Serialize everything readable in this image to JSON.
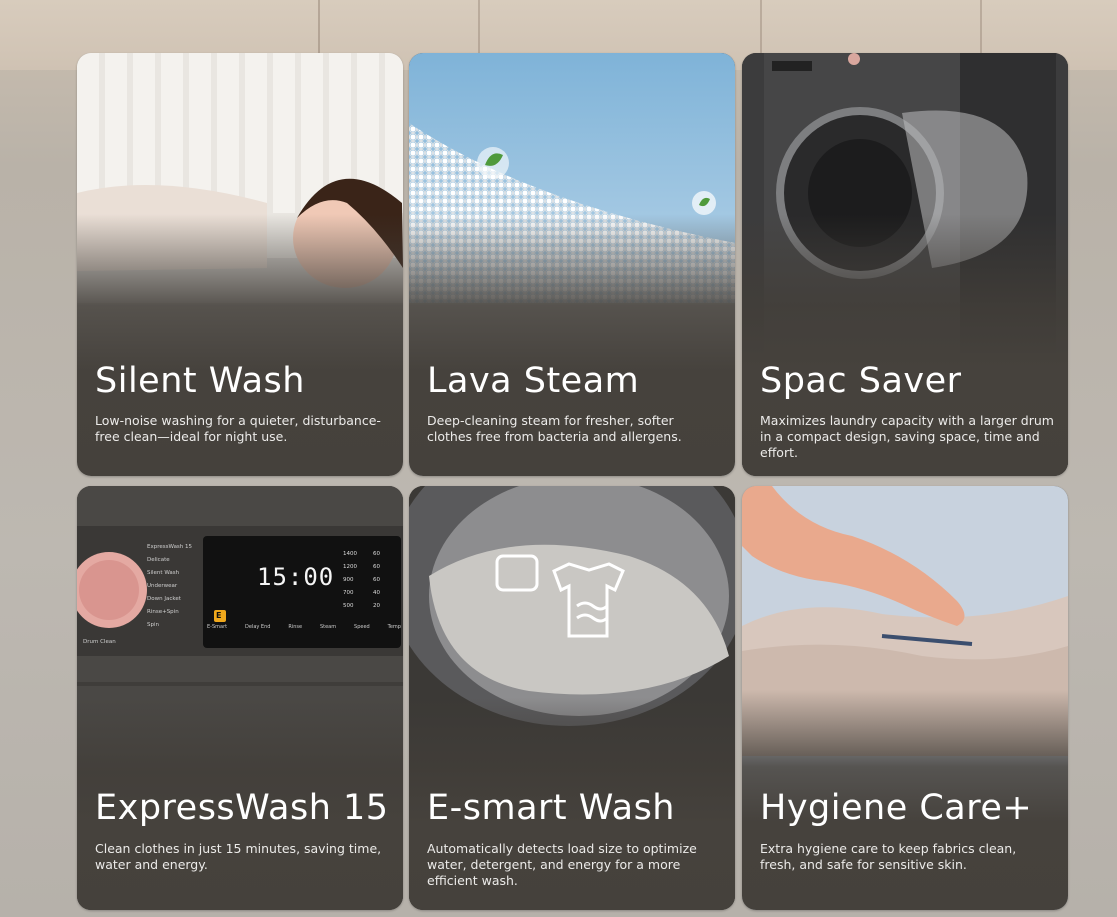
{
  "cards": [
    {
      "title": "Silent Wash",
      "desc": "Low-noise washing for a quieter, disturbance-free clean—ideal for night use."
    },
    {
      "title": "Lava Steam",
      "desc": "Deep-cleaning steam for fresher, softer clothes free from bacteria and allergens."
    },
    {
      "title": "Spac Saver",
      "desc": "Maximizes laundry capacity with a larger drum in a compact design, saving space, time and effort."
    },
    {
      "title": "ExpressWash 15",
      "desc": "Clean clothes in just 15 minutes, saving time, water and energy."
    },
    {
      "title": "E-smart Wash",
      "desc": "Automatically detects load size to optimize water, detergent, and energy for a more efficient wash."
    },
    {
      "title": "Hygiene Care+",
      "desc": "Extra hygiene care to keep fabrics clean, fresh, and safe for sensitive skin."
    }
  ],
  "panel": {
    "display_time": "15:00",
    "programs": [
      "ExpressWash 15",
      "Delicate",
      "Silent Wash",
      "Underwear",
      "Down Jacket",
      "Rinse+Spin",
      "Spin",
      "Drum Clean"
    ],
    "buttons": [
      "E-Smart",
      "Delay End",
      "Rinse",
      "Steam",
      "Speed",
      "Temp"
    ],
    "speeds": [
      "1400",
      "1200",
      "900",
      "700",
      "500"
    ],
    "temps": [
      "60",
      "60",
      "60",
      "40",
      "20"
    ],
    "e_badge": "E"
  },
  "colors": {
    "card_bg": "#45413c",
    "title": "#ffffff",
    "desc": "#ecebe9",
    "knob": "#e4a9a2"
  }
}
